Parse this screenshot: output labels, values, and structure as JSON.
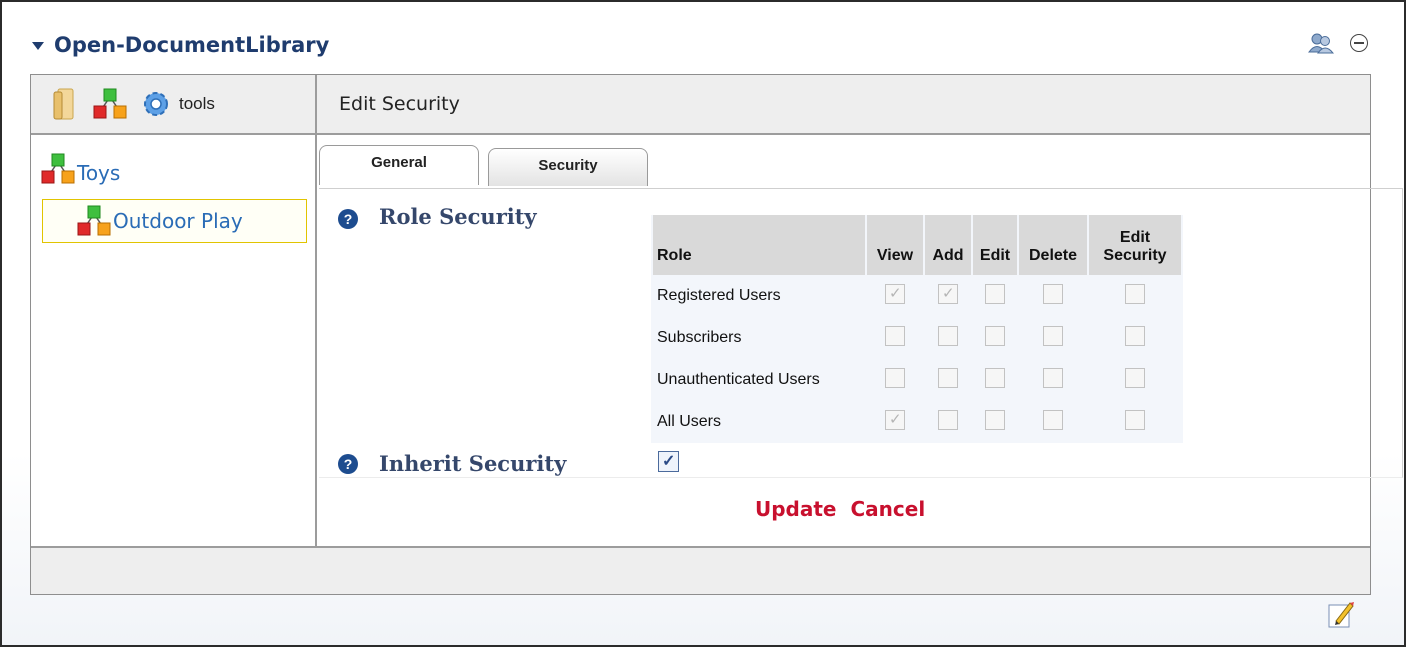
{
  "module": {
    "title": "Open-DocumentLibrary"
  },
  "toolbar": {
    "tools_label": "tools",
    "panel_title": "Edit Security"
  },
  "tree": {
    "root": "Toys",
    "child": "Outdoor Play"
  },
  "tabs": [
    {
      "label": "General"
    },
    {
      "label": "Security"
    }
  ],
  "role_security": {
    "label": "Role Security",
    "headers": {
      "role": "Role",
      "view": "View",
      "add": "Add",
      "edit": "Edit",
      "delete": "Delete",
      "edit_security_1": "Edit",
      "edit_security_2": "Security"
    },
    "rows": [
      {
        "role": "Registered Users",
        "view": true,
        "add": true,
        "edit": false,
        "delete": false,
        "edit_security": false
      },
      {
        "role": "Subscribers",
        "view": false,
        "add": false,
        "edit": false,
        "delete": false,
        "edit_security": false
      },
      {
        "role": "Unauthenticated Users",
        "view": false,
        "add": false,
        "edit": false,
        "delete": false,
        "edit_security": false
      },
      {
        "role": "All Users",
        "view": true,
        "add": false,
        "edit": false,
        "delete": false,
        "edit_security": false
      }
    ]
  },
  "inherit_security": {
    "label": "Inherit Security",
    "checked": true
  },
  "actions": {
    "update": "Update",
    "cancel": "Cancel"
  },
  "icons": {
    "collapse": "triangle-down-icon",
    "module_settings": "users-icon",
    "minimize": "circle-minus-icon",
    "folder": "folder-icon",
    "category": "category-cubes-icon",
    "tools": "gear-icon",
    "help": "question-circle-icon",
    "edit": "pencil-icon"
  },
  "colors": {
    "title": "#1f3c6e",
    "link": "#2a6cb6",
    "action": "#c8102e",
    "selection_border": "#e1c400"
  }
}
